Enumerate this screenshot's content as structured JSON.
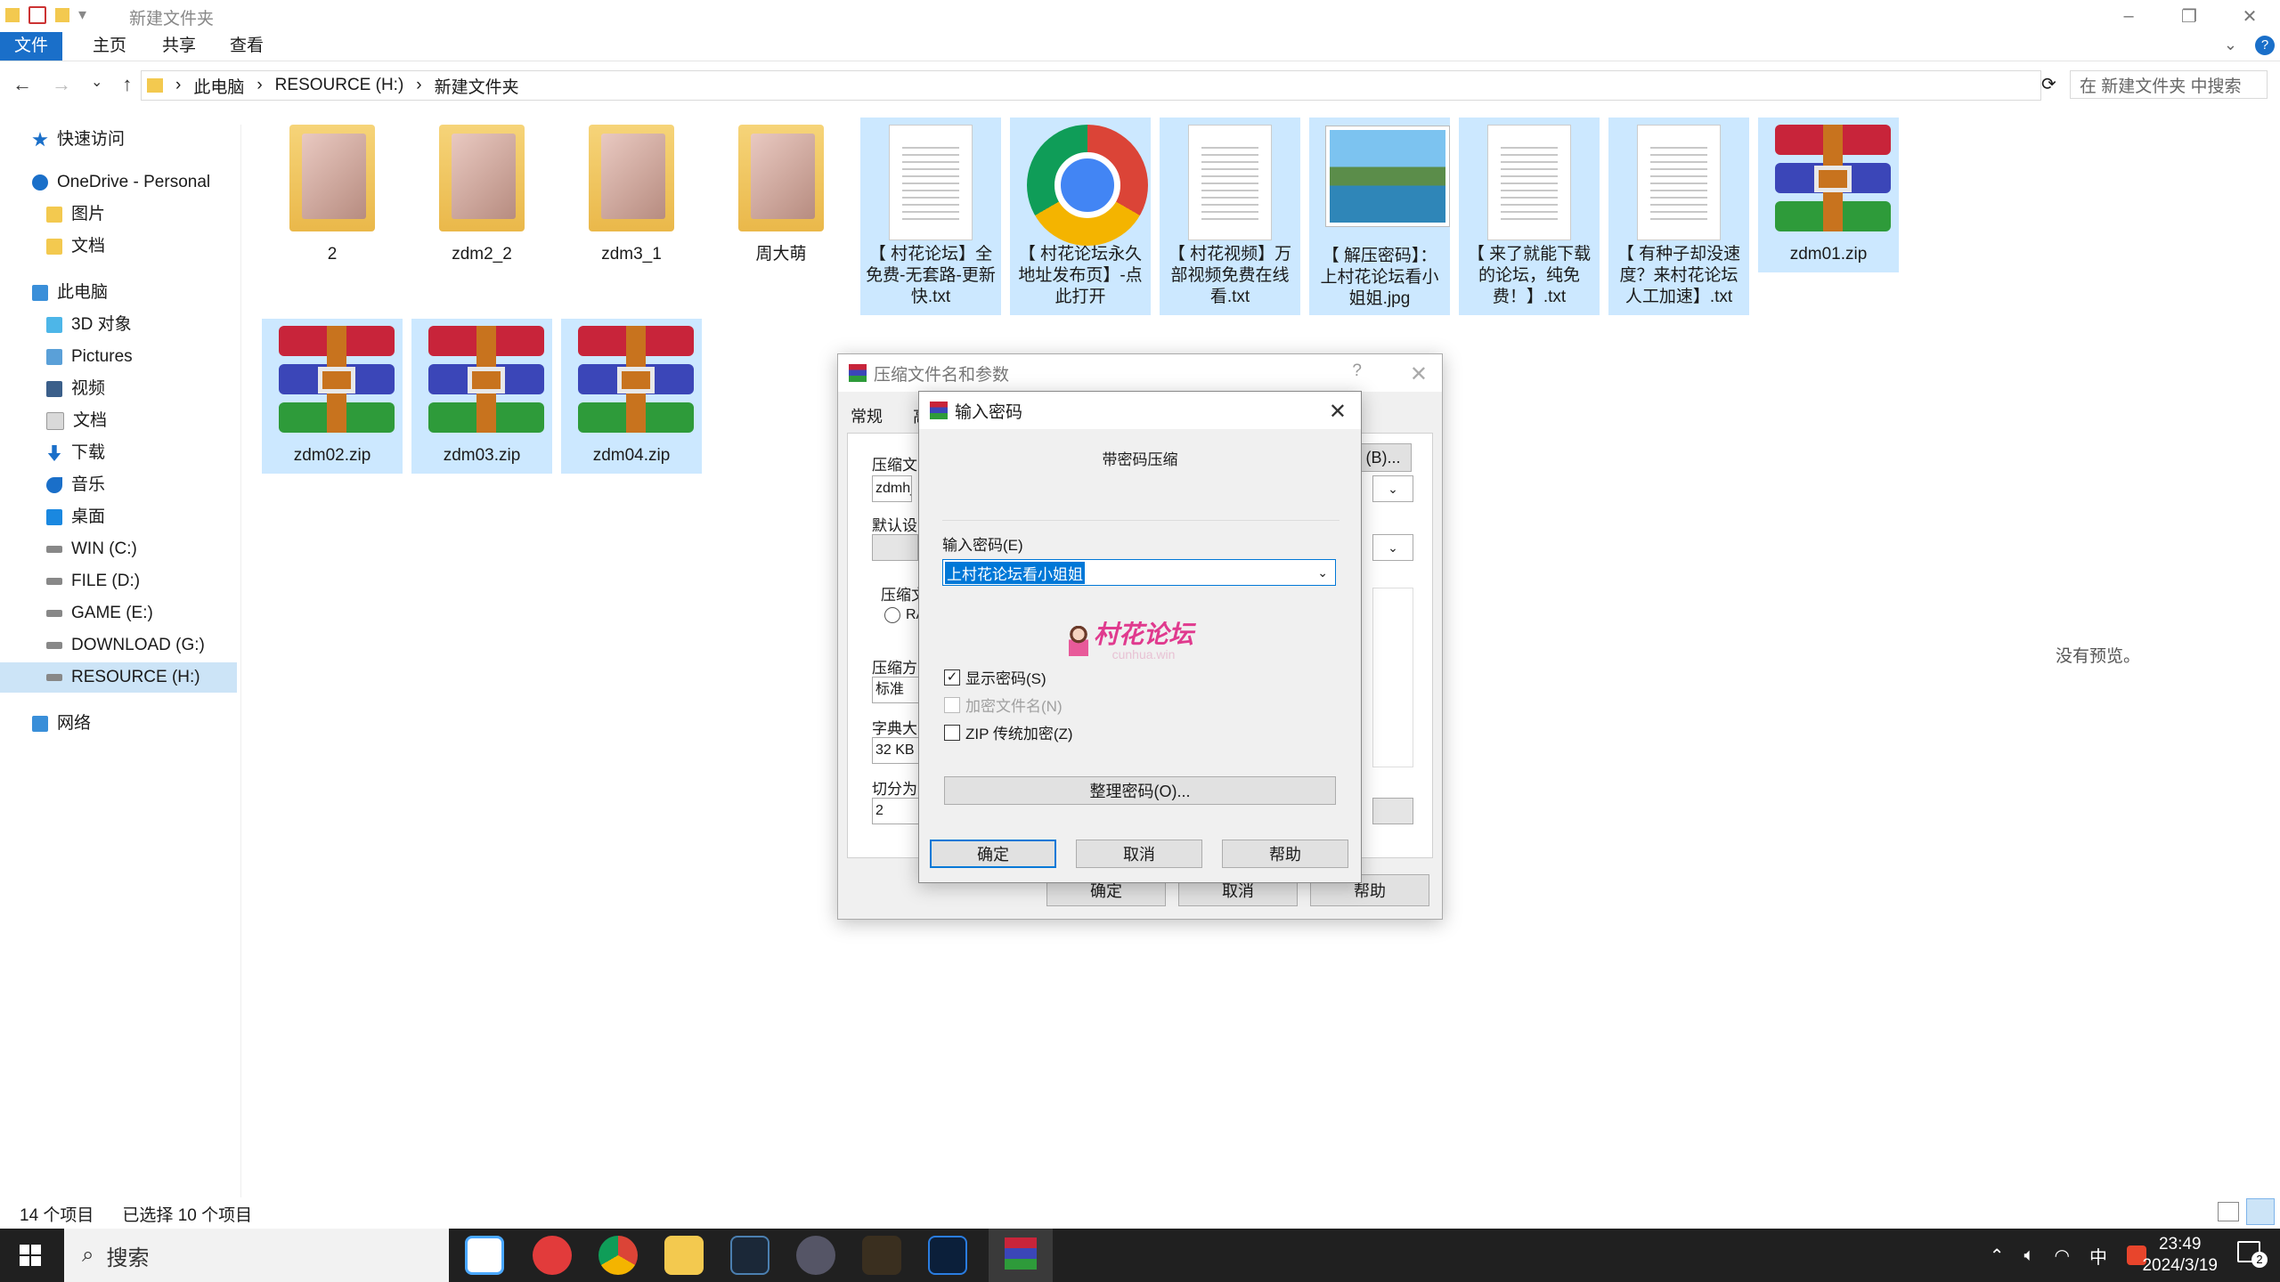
{
  "window": {
    "title": "新建文件夹",
    "controls": [
      "–",
      "❐",
      "✕"
    ]
  },
  "ribbon": {
    "tabs": [
      "文件",
      "主页",
      "共享",
      "查看"
    ]
  },
  "address": {
    "crumbs": [
      "此电脑",
      "RESOURCE (H:)",
      "新建文件夹"
    ],
    "search_placeholder": "在 新建文件夹 中搜索"
  },
  "sidebar": {
    "items": [
      {
        "label": "快速访问",
        "icon": "star-icon"
      },
      {
        "label": "OneDrive - Personal",
        "icon": "cloud-icon"
      },
      {
        "label": "图片",
        "icon": "folder-icon"
      },
      {
        "label": "文档",
        "icon": "folder-icon"
      },
      {
        "label": "此电脑",
        "icon": "pc-icon"
      },
      {
        "label": "3D 对象",
        "icon": "cube-icon"
      },
      {
        "label": "Pictures",
        "icon": "pictures-icon"
      },
      {
        "label": "视频",
        "icon": "video-icon"
      },
      {
        "label": "文档",
        "icon": "documents-icon"
      },
      {
        "label": "下载",
        "icon": "download-icon"
      },
      {
        "label": "音乐",
        "icon": "music-icon"
      },
      {
        "label": "桌面",
        "icon": "desktop-icon"
      },
      {
        "label": "WIN (C:)",
        "icon": "drive-icon"
      },
      {
        "label": "FILE (D:)",
        "icon": "drive-icon"
      },
      {
        "label": "GAME (E:)",
        "icon": "drive-icon"
      },
      {
        "label": "DOWNLOAD (G:)",
        "icon": "drive-icon"
      },
      {
        "label": "RESOURCE (H:)",
        "icon": "drive-icon"
      },
      {
        "label": "网络",
        "icon": "network-icon"
      }
    ]
  },
  "files": [
    {
      "name": "2",
      "kind": "folder"
    },
    {
      "name": "zdm2_2",
      "kind": "folder"
    },
    {
      "name": "zdm3_1",
      "kind": "folder"
    },
    {
      "name": "周大萌",
      "kind": "folder-mp4"
    },
    {
      "name": "【 村花论坛】全免费-无套路-更新快.txt",
      "kind": "txt"
    },
    {
      "name": "【 村花论坛永久地址发布页】-点此打开",
      "kind": "chrome"
    },
    {
      "name": "【 村花视频】万部视频免费在线看.txt",
      "kind": "txt"
    },
    {
      "name": "【 解压密码】：上村花论坛看小姐姐.jpg",
      "kind": "jpg"
    },
    {
      "name": "【 来了就能下载的论坛，纯免费！】.txt",
      "kind": "txt"
    },
    {
      "name": "【 有种子却没速度？来村花论坛人工加速】.txt",
      "kind": "txt"
    },
    {
      "name": "zdm01.zip",
      "kind": "rar"
    },
    {
      "name": "zdm02.zip",
      "kind": "rar"
    },
    {
      "name": "zdm03.zip",
      "kind": "rar"
    },
    {
      "name": "zdm04.zip",
      "kind": "rar"
    }
  ],
  "status": {
    "count": "14 个项目",
    "selected": "已选择 10 个项目"
  },
  "preview": {
    "text": "没有预览。"
  },
  "archive_dialog": {
    "title": "压缩文件名和参数",
    "help": "?",
    "tabs": [
      "常规",
      "高"
    ],
    "archive_name_label": "压缩文",
    "archive_name_value": "zdmhj",
    "browse_label": "(B)...",
    "default_label": "默认设",
    "format_label": "压缩文",
    "format_radio": "RA",
    "method_label": "压缩方",
    "method_value": "标准",
    "dict_label": "字典大",
    "dict_value": "32 KB",
    "split_label": "切分为",
    "split_value": "2",
    "ok": "确定",
    "cancel": "取消",
    "help_btn": "帮助"
  },
  "password_dialog": {
    "title": "输入密码",
    "heading": "带密码压缩",
    "field_label": "输入密码(E)",
    "field_value": "上村花论坛看小姐姐",
    "watermark": "村花论坛",
    "watermark_sub": "cunhua.win",
    "show_password": "显示密码(S)",
    "encrypt_names": "加密文件名(N)",
    "zip_legacy": "ZIP 传统加密(Z)",
    "organize": "整理密码(O)...",
    "ok": "确定",
    "cancel": "取消",
    "help": "帮助"
  },
  "taskbar": {
    "search": "搜索",
    "ime": "中",
    "time": "23:49",
    "date": "2024/3/19",
    "notifications": "2"
  }
}
